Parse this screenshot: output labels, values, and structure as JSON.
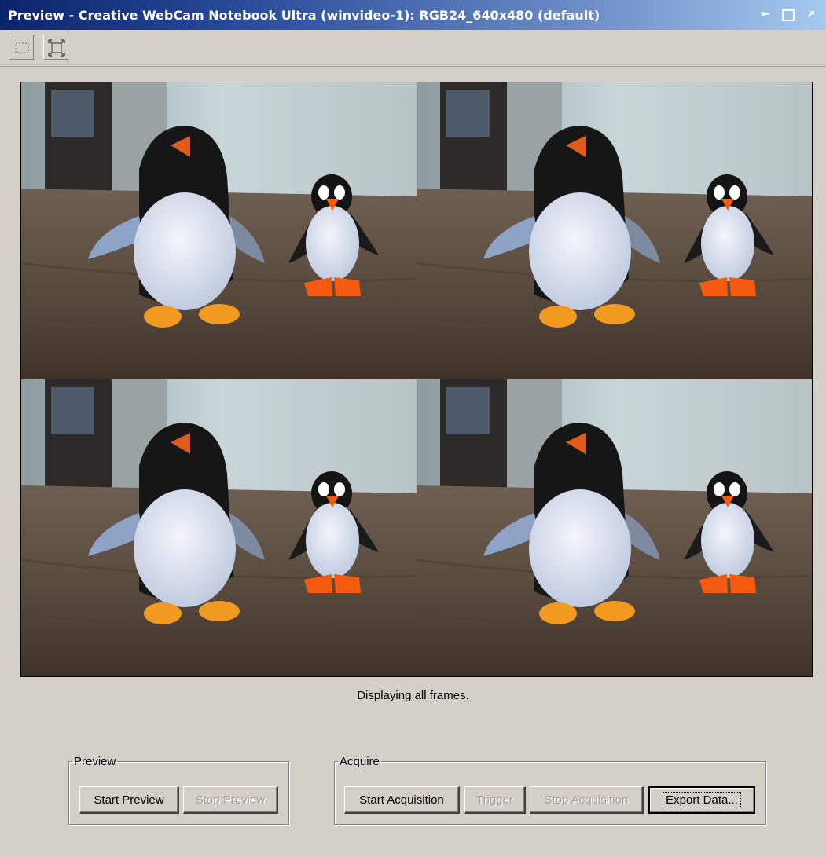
{
  "window": {
    "title": "Preview - Creative WebCam Notebook Ultra (winvideo-1): RGB24_640x480 (default)",
    "controls": [
      "dock-icon",
      "maximize-icon",
      "undock-icon"
    ]
  },
  "toolbar": {
    "tools": [
      {
        "name": "region-of-interest-tool",
        "icon": "dashed-rectangle-icon"
      },
      {
        "name": "fit-to-window-tool",
        "icon": "expand-corners-icon"
      }
    ]
  },
  "preview": {
    "layout": "2x2 frame grid",
    "status": "Displaying all frames."
  },
  "preview_group": {
    "legend": "Preview",
    "start_label": "Start Preview",
    "stop_label": "Stop Preview"
  },
  "acquire_group": {
    "legend": "Acquire",
    "start_label": "Start Acquisition",
    "trigger_label": "Trigger",
    "stop_label": "Stop Acquisition",
    "export_label": "Export Data..."
  }
}
